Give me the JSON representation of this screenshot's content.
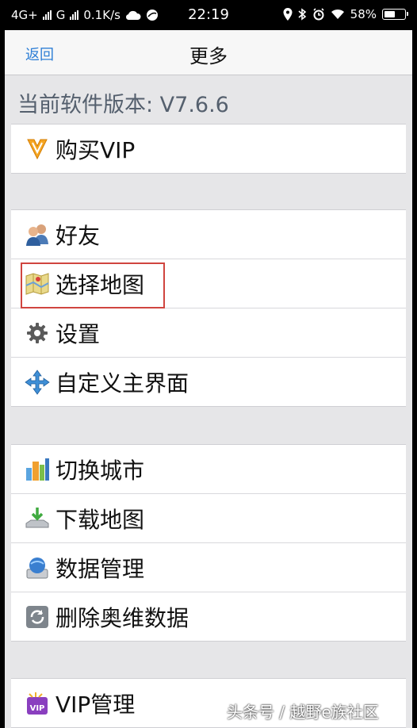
{
  "status_bar": {
    "network": "4G+",
    "carrier2": "G",
    "speed": "0.1K/s",
    "time": "22:19",
    "battery": "58%",
    "battery_level": 0.58
  },
  "nav": {
    "back_label": "返回",
    "title": "更多"
  },
  "version_text": "当前软件版本: V7.6.6",
  "groups": [
    {
      "items": [
        {
          "label": "购买VIP",
          "icon": "vip-badge-icon"
        }
      ]
    },
    {
      "items": [
        {
          "label": "好友",
          "icon": "friends-icon"
        },
        {
          "label": "选择地图",
          "icon": "map-icon"
        },
        {
          "label": "设置",
          "icon": "gear-icon"
        },
        {
          "label": "自定义主界面",
          "icon": "arrows-icon"
        }
      ]
    },
    {
      "items": [
        {
          "label": "切换城市",
          "icon": "city-icon"
        },
        {
          "label": "下载地图",
          "icon": "download-icon"
        },
        {
          "label": "数据管理",
          "icon": "database-icon"
        },
        {
          "label": "删除奥维数据",
          "icon": "refresh-icon"
        }
      ]
    },
    {
      "items": [
        {
          "label": "VIP管理",
          "icon": "vip-manage-icon"
        }
      ]
    }
  ],
  "colors": {
    "link": "#2f7fd6",
    "highlight_border": "#d0453f",
    "background": "#e6e6e8"
  },
  "watermark": "头条号 / 越野e族社区"
}
